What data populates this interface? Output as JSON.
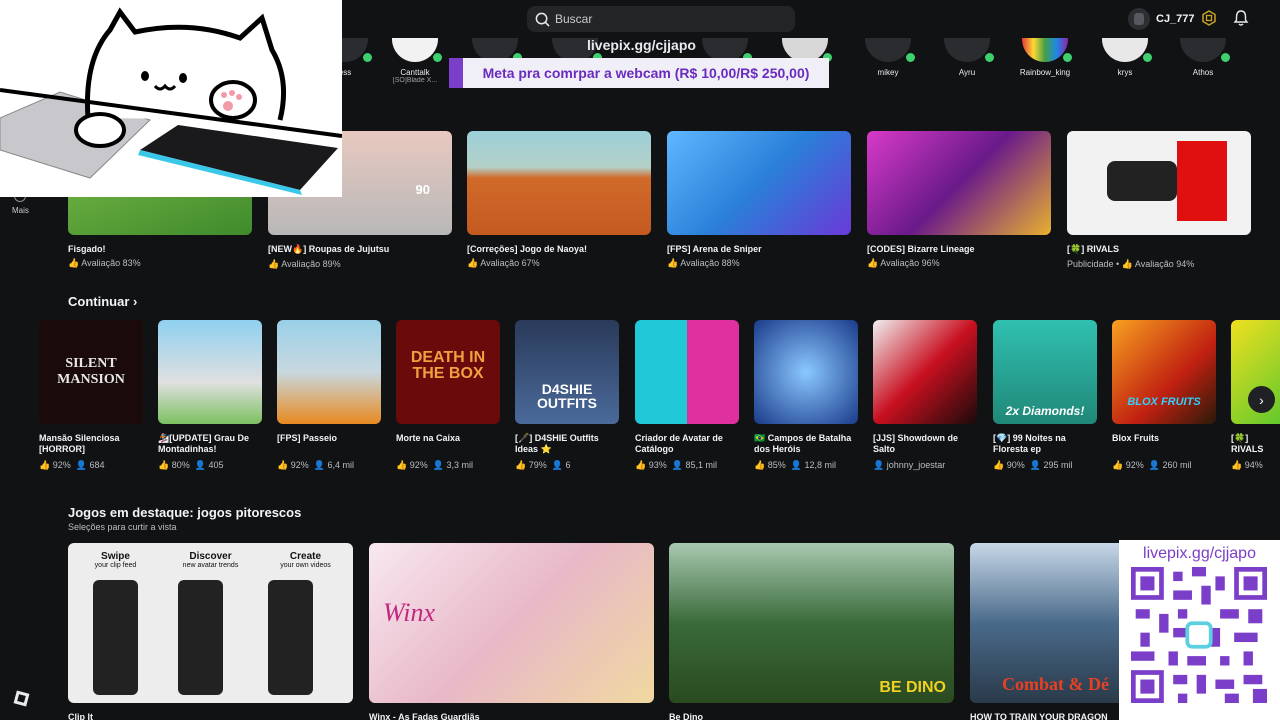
{
  "search": {
    "placeholder": "Buscar"
  },
  "user": {
    "name": "CJ_777"
  },
  "friends": [
    {
      "name": "ess",
      "sub": ""
    },
    {
      "name": "Canttalk",
      "sub": "[SÓ]Blade X..."
    },
    {
      "name": "mikey",
      "sub": ""
    },
    {
      "name": "Ayru",
      "sub": ""
    },
    {
      "name": "Rainbow_king",
      "sub": ""
    },
    {
      "name": "krys",
      "sub": ""
    },
    {
      "name": "Athos",
      "sub": ""
    }
  ],
  "overlay": {
    "url": "livepix.gg/cjjapo",
    "goal": "Meta pra comrpar a webcam (R$ 10,00/R$ 250,00)",
    "qr_url": "livepix.gg/cjjapo"
  },
  "sidebar": {
    "more_label": "Mais"
  },
  "big_cards": [
    {
      "title": "Fisgado!",
      "rating": "Avaliação 83%",
      "prefix": ""
    },
    {
      "title": "[NEW🔥] Roupas de Jujutsu",
      "rating": "Avaliação 89%",
      "prefix": "",
      "badge": "90"
    },
    {
      "title": "[Correções] Jogo de Naoya!",
      "rating": "Avaliação 67%",
      "prefix": ""
    },
    {
      "title": "[FPS] Arena de Sniper",
      "rating": "Avaliação 88%",
      "prefix": ""
    },
    {
      "title": "[CODES] Bizarre Lineage",
      "rating": "Avaliação 96%",
      "prefix": ""
    },
    {
      "title": "[🍀] RIVALS",
      "rating": "Avaliação 94%",
      "prefix": "Publicidade • "
    }
  ],
  "continue": {
    "heading": "Continuar",
    "cards": [
      {
        "title": "Mansão Silenciosa [HORROR]",
        "rating": "92%",
        "players": "684",
        "overlay": "SILENT MANSION"
      },
      {
        "title": "🏂[UPDATE] Grau De Montadinhas!",
        "rating": "80%",
        "players": "405",
        "overlay": ""
      },
      {
        "title": "[FPS] Passeio",
        "rating": "92%",
        "players": "6,4 mil",
        "overlay": ""
      },
      {
        "title": "Morte na Caixa",
        "rating": "92%",
        "players": "3,3 mil",
        "overlay": "DEATH IN THE BOX"
      },
      {
        "title": "[🖋️] D4SHIE Outfits Ideas ⭐",
        "rating": "79%",
        "players": "6",
        "overlay": "D4SHIE OUTFITS"
      },
      {
        "title": "Criador de Avatar de Catálogo",
        "rating": "93%",
        "players": "85,1 mil",
        "overlay": ""
      },
      {
        "title": "🇧🇷 Campos de Batalha dos Heróis",
        "rating": "85%",
        "players": "12,8 mil",
        "overlay": ""
      },
      {
        "title": "[JJS] Showdown de Salto",
        "rating": "",
        "players": "",
        "creator": "johnny_joestar",
        "overlay": ""
      },
      {
        "title": "[💎] 99 Noites na Floresta ep",
        "rating": "90%",
        "players": "295 mil",
        "overlay": "2x Diamonds!"
      },
      {
        "title": "Blox Fruits",
        "rating": "92%",
        "players": "260 mil",
        "overlay": "BLOX FRUITS"
      },
      {
        "title": "[🍀] RIVALS",
        "rating": "94%",
        "players": "",
        "overlay": ""
      }
    ]
  },
  "featured": {
    "heading": "Jogos em destaque: jogos pitorescos",
    "subheading": "Seleções para curtir a vista",
    "cards": [
      {
        "title": "Clip It",
        "labels": [
          "Swipe",
          "your clip feed",
          "Discover",
          "new avatar trends",
          "Create",
          "your own videos"
        ]
      },
      {
        "title": "Winx - As Fadas Guardiãs",
        "overlay": "Winx"
      },
      {
        "title": "Be Dino",
        "overlay": "BE DINO"
      },
      {
        "title": "HOW TO TRAIN YOUR DRAGON",
        "overlay": "Combat & Dé"
      }
    ]
  },
  "colors": {
    "bg": "#111214",
    "online": "#3ecf6e",
    "overlay_purple": "#7a3ec8"
  }
}
